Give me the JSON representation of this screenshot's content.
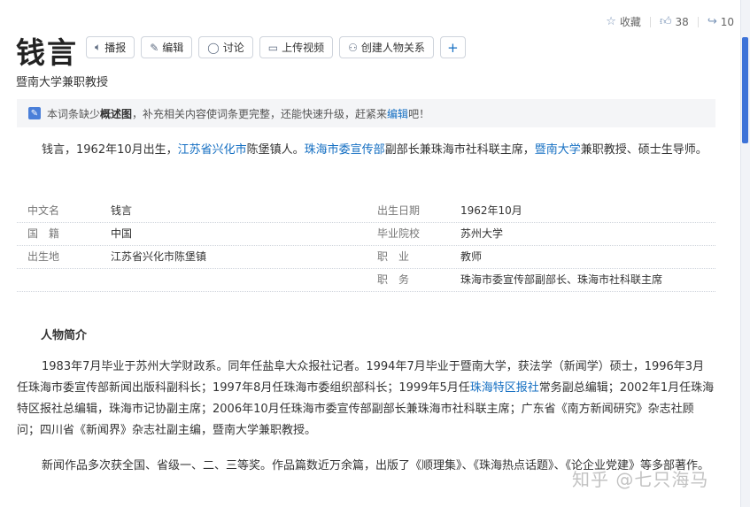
{
  "actions": {
    "collect": "收藏",
    "like_count": "38",
    "share_count": "10"
  },
  "title": "钱言",
  "subtitle": "暨南大学兼职教授",
  "toolbar": {
    "broadcast": "播报",
    "edit": "编辑",
    "discuss": "讨论",
    "upload_video": "上传视频",
    "create_relation": "创建人物关系",
    "plus": "+"
  },
  "notice": {
    "text1": "本词条缺少",
    "bold": "概述图",
    "text2": "，补充相关内容使词条更完整，还能快速升级，赶紧来",
    "link": "编辑",
    "text3": "吧！"
  },
  "summary": {
    "t1": "钱言，1962年10月出生，",
    "l1": "江苏省兴化市",
    "t2": "陈堡镇人。",
    "l2": "珠海市委宣传部",
    "t3": "副部长兼珠海市社科联主席，",
    "l3": "暨南大学",
    "t4": "兼职教授、硕士生导师。"
  },
  "info": {
    "left": [
      {
        "label": "中文名",
        "value": "钱言"
      },
      {
        "label": "国　籍",
        "value": "中国"
      },
      {
        "label": "出生地",
        "value": "江苏省兴化市陈堡镇"
      }
    ],
    "right": [
      {
        "label": "出生日期",
        "value": "1962年10月"
      },
      {
        "label": "毕业院校",
        "value": "苏州大学"
      },
      {
        "label": "职　业",
        "value": "教师"
      },
      {
        "label": "职　务",
        "value": "珠海市委宣传部副部长、珠海市社科联主席"
      }
    ]
  },
  "section": {
    "title": "人物简介"
  },
  "bio": {
    "p1a": "1983年7月毕业于苏州大学财政系。同年任盐阜大众报社记者。1994年7月毕业于暨南大学，获法学（新闻学）硕士，1996年3月任珠海市委宣传部新闻出版科副科长；1997年8月任珠海市委组织部科长；1999年5月任",
    "p1link": "珠海特区报社",
    "p1b": "常务副总编辑；2002年1月任珠海特区报社总编辑，珠海市记协副主席；2006年10月任珠海市委宣传部副部长兼珠海市社科联主席；广东省《南方新闻研究》杂志社顾问；四川省《新闻界》杂志社副主编，暨南大学兼职教授。",
    "p2": "新闻作品多次获全国、省级一、二、三等奖。作品篇数近万余篇，出版了《顺理集》、《珠海热点话题》、《论企业党建》等多部著作。"
  },
  "watermark": "知乎 @七只海马",
  "colors": {
    "link": "#136ec2",
    "accent": "#3d73d8",
    "notice_bg": "#f4f5f7"
  }
}
